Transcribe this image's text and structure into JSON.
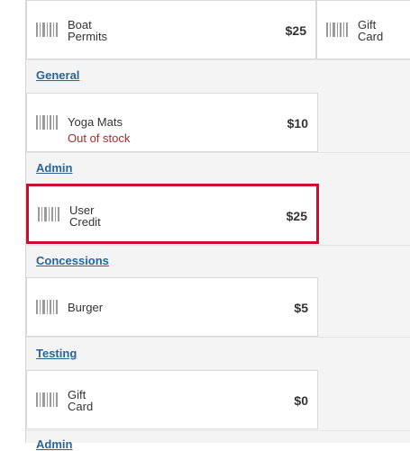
{
  "categories": [
    {
      "title": ""
    },
    {
      "title": "General"
    },
    {
      "title": "Admin"
    },
    {
      "title": "Concessions"
    },
    {
      "title": "Testing"
    },
    {
      "title": "Admin"
    }
  ],
  "items": [
    {
      "name_line1": "Boat",
      "name_line2": "Permits",
      "price": "$25"
    },
    {
      "name_line1": "Gift",
      "name_line2": "Card",
      "price": ""
    },
    {
      "name_line1": "Yoga Mats",
      "name_line2": "",
      "price": "$10",
      "status": "Out of stock"
    },
    {
      "name_line1": "User",
      "name_line2": "Credit",
      "price": "$25"
    },
    {
      "name_line1": "Burger",
      "name_line2": "",
      "price": "$5"
    },
    {
      "name_line1": "Gift",
      "name_line2": "Card",
      "price": "$0"
    }
  ],
  "colors": {
    "link": "#2a6496",
    "selected_border": "#c8102e",
    "out_of_stock": "#b3272d"
  }
}
